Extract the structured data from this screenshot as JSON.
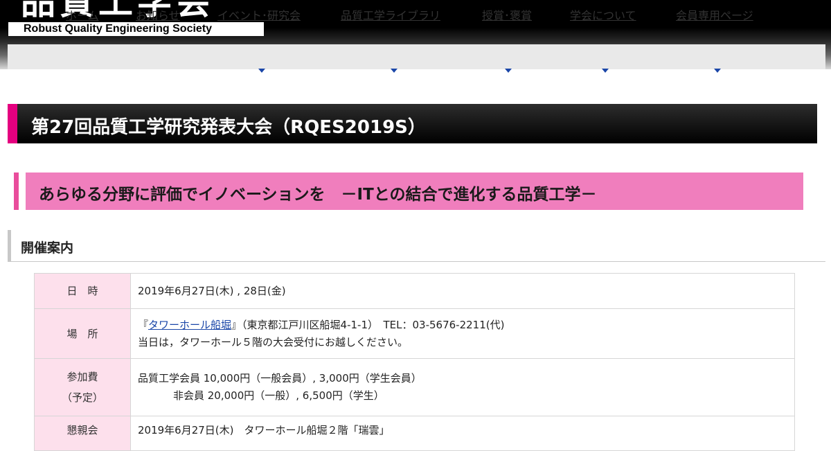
{
  "header": {
    "logo_jp": "品質工学会",
    "logo_en": "Robust Quality Engineering Society"
  },
  "nav": {
    "items": [
      {
        "label": "ホーム"
      },
      {
        "label": "お知らせ"
      },
      {
        "label": "イベント･研究会"
      },
      {
        "label": "品質工学ライブラリ"
      },
      {
        "label": "授賞･褒賞"
      },
      {
        "label": "学会について"
      },
      {
        "label": "会員専用ページ"
      }
    ]
  },
  "title": "第27回品質工学研究発表大会（RQES2019S）",
  "theme": "あらゆる分野に評価でイノベーションを　－ITとの結合で進化する品質工学－",
  "section": "開催案内",
  "colors": {
    "accent_magenta": "#e4007f",
    "theme_pink": "#f07ebd",
    "table_header_pink": "#fde0ec",
    "link_blue": "#1a46a8"
  },
  "table": {
    "date": {
      "label": "日　時",
      "value": "2019年6月27日(木) , 28日(金)"
    },
    "venue": {
      "label": "場　所",
      "open_quote": "『",
      "link": "タワーホール船堀",
      "rest": "』（東京都江戸川区船堀4-1-1）　TEL：03-5676-2211(代)",
      "note": "当日は，タワーホール５階の大会受付にお越しください。"
    },
    "fee": {
      "label1": "参加費",
      "label2": "（予定）",
      "line1": "品質工学会員 10,000円（一般会員）,  3,000円（学生会員）",
      "line2": "非会員 20,000円（一般）,  6,500円（学生）"
    },
    "party": {
      "label": "懇親会",
      "value": "2019年6月27日(木)　タワーホール船堀２階「瑞雲」"
    }
  }
}
